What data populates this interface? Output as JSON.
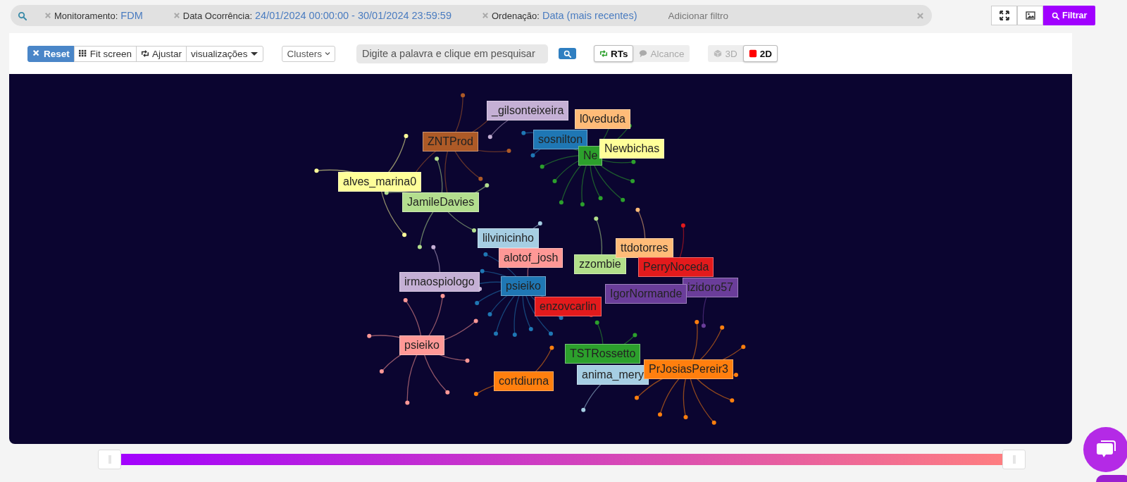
{
  "filter_bar": {
    "chips": [
      {
        "label": "Monitoramento:",
        "value": "FDM"
      },
      {
        "label": "Data Ocorrência:",
        "value": "24/01/2024 00:00:00 - 30/01/2024 23:59:59"
      },
      {
        "label": "Ordenação:",
        "value": "Data (mais recentes)"
      }
    ],
    "placeholder": "Adicionar filtro",
    "filter_button": "Filtrar"
  },
  "toolbar": {
    "view_buttons": [
      {
        "label": "Reset",
        "selected": true
      },
      {
        "label": "Fit screen",
        "selected": false
      },
      {
        "label": "Ajustar",
        "selected": false
      },
      {
        "label": "visualizações",
        "selected": false
      }
    ],
    "clusters": "Clusters",
    "search": {
      "placeholder": "Digite a palavra e clique em pesquisar"
    },
    "metric_toggle": [
      {
        "label": "RTs",
        "selected": true
      },
      {
        "label": "Alcance",
        "selected": false
      }
    ],
    "mode_toggle": [
      {
        "label": "3D",
        "selected": false
      },
      {
        "label": "2D",
        "selected": true
      }
    ]
  },
  "graph": {
    "nodes": [
      {
        "label": "_gilsonteixeira",
        "color": "#c5b0d5"
      },
      {
        "label": "ZNTProd",
        "color": "#ad5a27"
      },
      {
        "label": "alves_marina0",
        "color": "#ffff99"
      },
      {
        "label": "JamileDavies",
        "color": "#b3de8e"
      },
      {
        "label": "sosnilton",
        "color": "#1f77b4"
      },
      {
        "label": "l0veduda",
        "color": "#ffbb78"
      },
      {
        "label": "Ne",
        "color": "#2ca02c"
      },
      {
        "label": "Newbichas",
        "color": "#ffff99"
      },
      {
        "label": "lilvinicinho",
        "color": "#a6cee3"
      },
      {
        "label": "alotof_josh",
        "color": "#ff9896"
      },
      {
        "label": "zzombie",
        "color": "#b2df8a"
      },
      {
        "label": "ttdotorres",
        "color": "#ffbb78"
      },
      {
        "label": "PerryNoceda",
        "color": "#e31a1c"
      },
      {
        "label": "izidoro57",
        "color": "#6a3d9a"
      },
      {
        "label": "IgorNormande",
        "color": "#6a3d9a"
      },
      {
        "label": "irmaospiologo",
        "color": "#c5b0d5"
      },
      {
        "label": "psieiko",
        "color": "#1f77b4"
      },
      {
        "label": "enzovcarlin",
        "color": "#e31a1c"
      },
      {
        "label": "psieiko",
        "color": "#ff9896"
      },
      {
        "label": "cortdiurna",
        "color": "#ff7f0e"
      },
      {
        "label": "TSTRossetto",
        "color": "#2ca02c"
      },
      {
        "label": "anima_mery",
        "color": "#a6cee3"
      },
      {
        "label": "PrJosiasPereir3",
        "color": "#ff7f0e"
      }
    ]
  },
  "timeline": {
    "handles": [
      {
        "level": 0
      },
      {
        "level": 1
      }
    ]
  }
}
